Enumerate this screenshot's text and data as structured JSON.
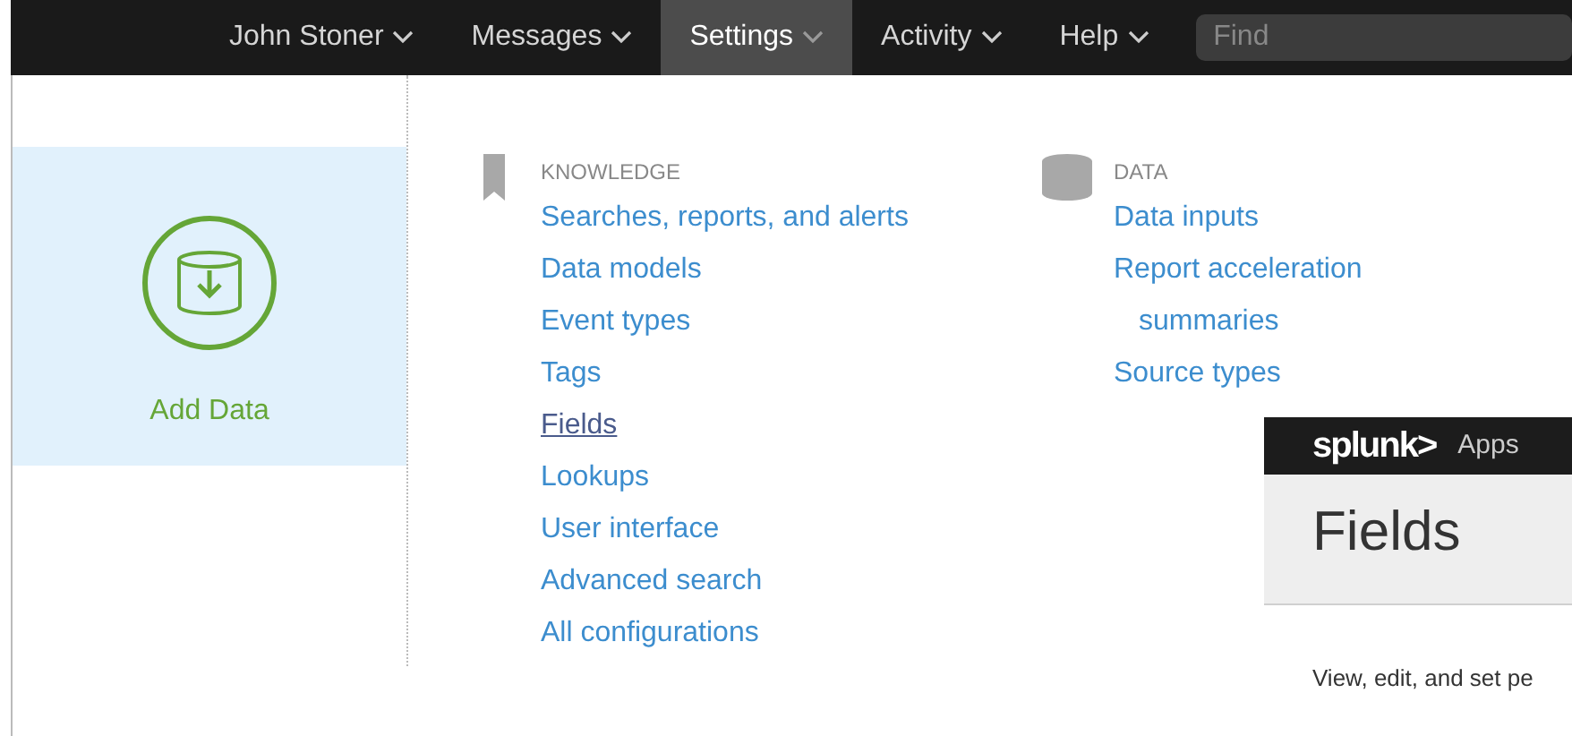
{
  "top_menu": [
    {
      "label": "John Stoner",
      "selected": false
    },
    {
      "label": "Messages",
      "selected": false
    },
    {
      "label": "Settings",
      "selected": true
    },
    {
      "label": "Activity",
      "selected": false
    },
    {
      "label": "Help",
      "selected": false
    }
  ],
  "search": {
    "placeholder": "Find"
  },
  "add_data": {
    "label": "Add Data"
  },
  "sections": [
    {
      "kind": "knowledge",
      "heading": "KNOWLEDGE",
      "links": [
        {
          "label": "Searches, reports, and alerts",
          "selected": false
        },
        {
          "label": "Data models",
          "selected": false
        },
        {
          "label": "Event types",
          "selected": false
        },
        {
          "label": "Tags",
          "selected": false
        },
        {
          "label": "Fields",
          "selected": true
        },
        {
          "label": "Lookups",
          "selected": false
        },
        {
          "label": "User interface",
          "selected": false
        },
        {
          "label": "Advanced search",
          "selected": false
        },
        {
          "label": "All configurations",
          "selected": false
        }
      ]
    },
    {
      "kind": "data",
      "heading": "DATA",
      "links": [
        {
          "label": "Data inputs",
          "selected": false
        },
        {
          "label": "Report acceleration summaries",
          "selected": false
        },
        {
          "label": "Source types",
          "selected": false
        }
      ]
    }
  ],
  "inset": {
    "logo": "splunk>",
    "menu": "Apps",
    "title": "Fields",
    "description": "View, edit, and set pe"
  }
}
